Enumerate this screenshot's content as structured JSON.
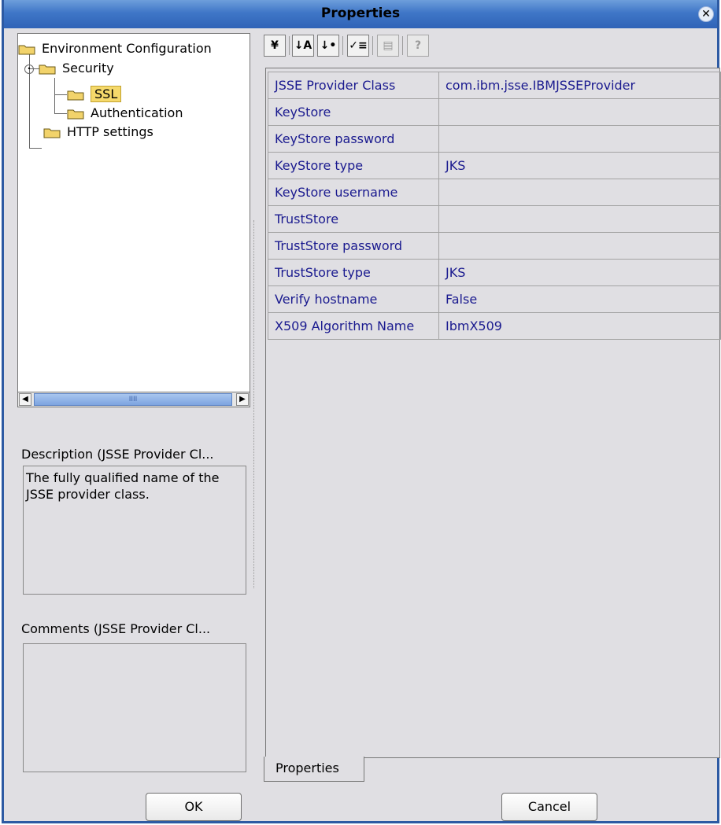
{
  "window": {
    "title": "Properties"
  },
  "tree": {
    "root": "Environment Configuration",
    "security": "Security",
    "ssl": "SSL",
    "authentication": "Authentication",
    "http": "HTTP settings"
  },
  "description": {
    "label": "Description (JSSE Provider Cl...",
    "text": "The fully qualified name of the JSSE provider class."
  },
  "comments": {
    "label": "Comments (JSSE Provider Cl...",
    "text": ""
  },
  "properties": [
    {
      "name": "JSSE Provider Class",
      "value": "com.ibm.jsse.IBMJSSEProvider"
    },
    {
      "name": "KeyStore",
      "value": ""
    },
    {
      "name": "KeyStore password",
      "value": ""
    },
    {
      "name": "KeyStore type",
      "value": "JKS"
    },
    {
      "name": "KeyStore username",
      "value": ""
    },
    {
      "name": "TrustStore",
      "value": ""
    },
    {
      "name": "TrustStore password",
      "value": ""
    },
    {
      "name": "TrustStore type",
      "value": "JKS"
    },
    {
      "name": "Verify hostname",
      "value": "False"
    },
    {
      "name": "X509 Algorithm Name",
      "value": "IbmX509"
    }
  ],
  "tab": {
    "label": "Properties"
  },
  "buttons": {
    "ok": "OK",
    "cancel": "Cancel"
  },
  "colors": {
    "title_bar": "#3f76c7",
    "selection": "#f5d96b",
    "property_text": "#1a1a8f",
    "folder": "#f2d36b"
  }
}
